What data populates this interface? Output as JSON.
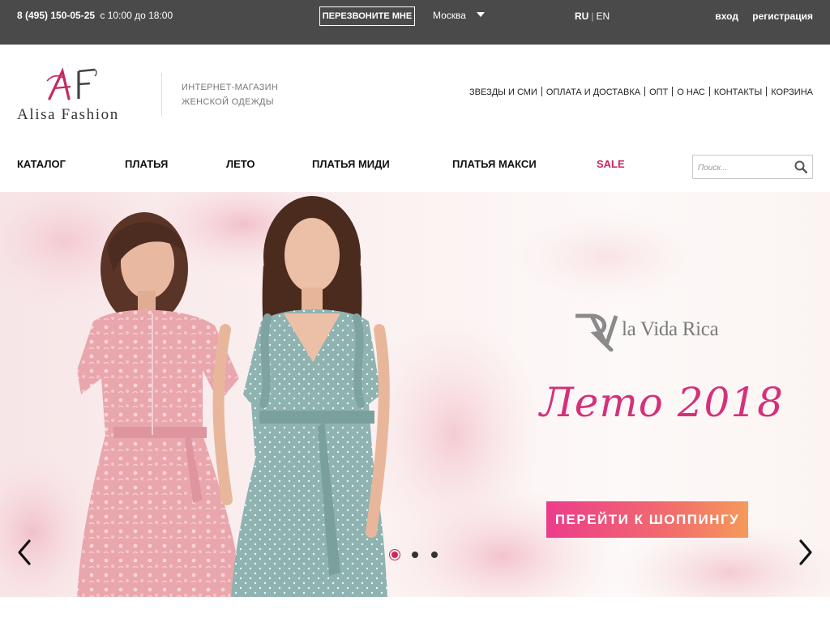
{
  "topbar": {
    "phone": "8 (495) 150-05-25",
    "hours": "с 10:00 до 18:00",
    "callback_label": "ПЕРЕЗВОНИТЕ МНЕ",
    "city": "Москва",
    "lang_active": "RU",
    "lang_other": "EN",
    "login_label": "вход",
    "register_label": "регистрация"
  },
  "header": {
    "logo_monogram": "AF",
    "logo_text": "Alisa Fashion",
    "tagline_line1": "ИНТЕРНЕТ-МАГАЗИН",
    "tagline_line2": "ЖЕНСКОЙ ОДЕЖДЫ",
    "links": [
      "ЗВЕЗДЫ И СМИ",
      "ОПЛАТА И ДОСТАВКА",
      "ОПТ",
      "О НАС",
      "КОНТАКТЫ",
      "КОРЗИНА"
    ]
  },
  "mainnav": {
    "items": [
      "КАТАЛОГ",
      "ПЛАТЬЯ",
      "ЛЕТО",
      "ПЛАТЬЯ МИДИ",
      "ПЛАТЬЯ МАКСИ",
      "SALE"
    ]
  },
  "search": {
    "placeholder": "Поиск...",
    "icon": "search-icon"
  },
  "hero": {
    "brand_name": "la Vida Rica",
    "slogan": "Лето 2018",
    "cta_label": "ПЕРЕЙТИ К ШОППИНГУ",
    "slides_total": 3,
    "active_slide": 1,
    "prev_icon": "chevron-left-icon",
    "next_icon": "chevron-right-icon"
  },
  "colors": {
    "topbar_bg": "#4a4a4a",
    "accent": "#c52a5a",
    "slogan": "#d4317a",
    "cta_start": "#ec3c8b",
    "cta_end": "#f59a5a"
  }
}
